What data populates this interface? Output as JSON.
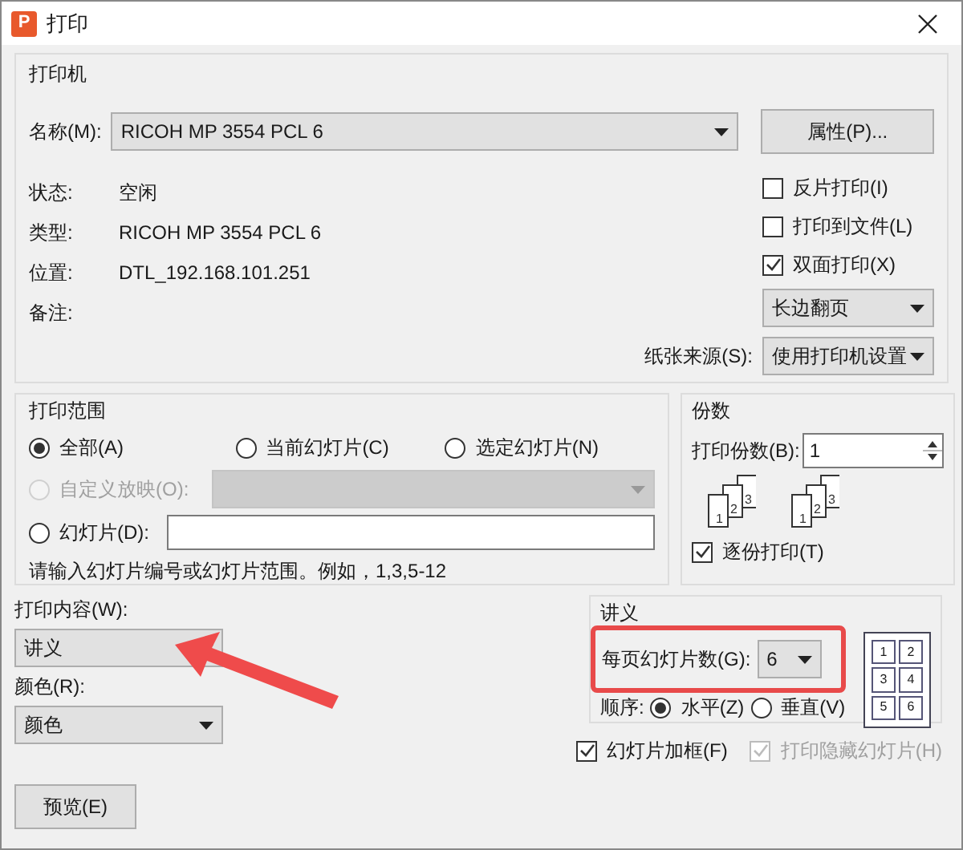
{
  "window": {
    "title": "打印",
    "icon_letter": "P"
  },
  "printer": {
    "title": "打印机",
    "name_label": "名称(M):",
    "name_value": "RICOH MP 3554 PCL 6",
    "properties_button": "属性(P)...",
    "info": [
      {
        "label": "状态:",
        "value": "空闲"
      },
      {
        "label": "类型:",
        "value": "RICOH MP 3554 PCL 6"
      },
      {
        "label": "位置:",
        "value": "DTL_192.168.101.251"
      },
      {
        "label": "备注:"
      }
    ],
    "options": [
      {
        "label": "反片打印(I)",
        "checked": false
      },
      {
        "label": "打印到文件(L)",
        "checked": false
      },
      {
        "label": "双面打印(X)",
        "checked": true
      }
    ],
    "duplex_value": "长边翻页",
    "paper_source_label": "纸张来源(S):",
    "paper_source_value": "使用打印机设置"
  },
  "range": {
    "title": "打印范围",
    "choices": [
      {
        "label": "全部(A)",
        "selected": true
      },
      {
        "label": "当前幻灯片(C)",
        "selected": false
      },
      {
        "label": "选定幻灯片(N)",
        "selected": false
      }
    ],
    "custom_show": {
      "label": "自定义放映(O):",
      "selected": false,
      "disabled": true
    },
    "slides": {
      "label": "幻灯片(D):",
      "selected": false
    },
    "hint": "请输入幻灯片编号或幻灯片范围。例如，1,3,5-12"
  },
  "copies": {
    "title": "份数",
    "count_label": "打印份数(B):",
    "count_value": "1",
    "collate": {
      "label": "逐份打印(T)",
      "checked": true
    },
    "stacks": [
      {
        "pages": [
          "1",
          "2",
          "3"
        ]
      },
      {
        "pages": [
          "1",
          "2",
          "3"
        ]
      }
    ]
  },
  "print_content": {
    "label": "打印内容(W):",
    "value": "讲义",
    "pointer_arrow": true
  },
  "color": {
    "label": "颜色(R):",
    "value": "颜色"
  },
  "handouts": {
    "title": "讲义",
    "per_page_label": "每页幻灯片数(G):",
    "per_page_value": "6",
    "highlighted": true,
    "order_label": "顺序:",
    "orders": [
      {
        "label": "水平(Z)",
        "selected": true
      },
      {
        "label": "垂直(V)",
        "selected": false
      }
    ],
    "layout_numbers": [
      "1",
      "2",
      "3",
      "4",
      "5",
      "6"
    ]
  },
  "bottom_options": [
    {
      "label": "幻灯片加框(F)",
      "checked": true,
      "disabled": false
    },
    {
      "label": "打印隐藏幻灯片(H)",
      "checked": true,
      "disabled": true
    }
  ],
  "preview_button": "预览(E)"
}
